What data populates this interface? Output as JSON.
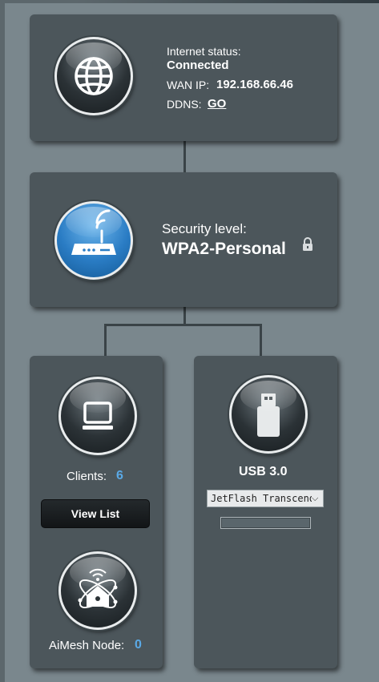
{
  "internet": {
    "status_label": "Internet status:",
    "status_value": "Connected",
    "wan_ip_label": "WAN IP:",
    "wan_ip_value": "192.168.66.46",
    "ddns_label": "DDNS:",
    "ddns_link": "GO",
    "icon": "globe-icon"
  },
  "security": {
    "label": "Security level:",
    "value": "WPA2-Personal",
    "icon": "router-icon",
    "lock_icon": "lock-icon"
  },
  "clients": {
    "label": "Clients:",
    "count": "6",
    "view_list_label": "View List",
    "icon": "monitor-icon"
  },
  "aimesh": {
    "label": "AiMesh Node:",
    "count": "0",
    "icon": "aimesh-node-icon"
  },
  "usb": {
    "title": "USB 3.0",
    "device_selected": "JetFlash Transcend",
    "icon": "usb-drive-icon",
    "usage_fraction": 0
  },
  "colors": {
    "accent_blue": "#5aa9e6",
    "card_bg": "#4c565b",
    "page_bg": "#7a878d"
  }
}
